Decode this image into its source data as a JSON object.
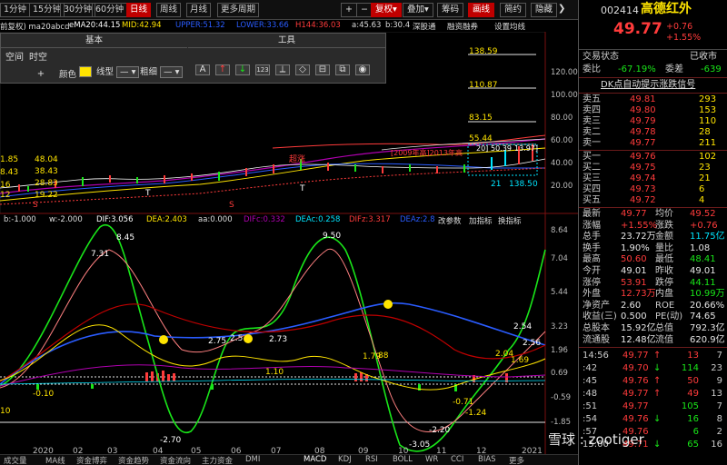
{
  "toolbar": {
    "tabs": [
      "1分钟",
      "15分钟",
      "30分钟",
      "60分钟",
      "日线",
      "周线",
      "月线",
      "更多周期"
    ],
    "active_tab": "日线",
    "buttons": [
      "+",
      "−",
      "复权",
      "叠加",
      "筹码",
      "画线",
      "简约",
      "隐藏"
    ],
    "fuquan_arrow": "▾",
    "dieja_arrow": "▾"
  },
  "ma_strip": {
    "left": "前复权)  ma20abcd",
    "ema20": "eMA20:44.15",
    "mid": "MID:42.94",
    "upr": "UPPER:51.32",
    "lwr": "LOWER:33.66",
    "h1": "H144:36.03",
    "a": "a:45.63",
    "b": "b:30.4",
    "deep": "深股通",
    "margin": "融资融券",
    "setting": "设置均线"
  },
  "drawbar": {
    "hdr_basic": "基本",
    "hdr_tools": "工具",
    "row1": [
      "空间",
      "时空"
    ],
    "plus": "+",
    "color_label": "颜色",
    "linetype_label": "线型",
    "thickness_label": "粗细",
    "tools": [
      "A",
      "↑",
      "↓",
      "123",
      "⟂",
      "◇",
      "⊟",
      "⧉",
      "◉"
    ]
  },
  "main_chart": {
    "right_axis": [
      "120.00",
      "100.00",
      "80.00",
      "60.00",
      "40.00",
      "20.00"
    ],
    "hlines": [
      "138.59",
      "110.87",
      "83.15",
      "55.44"
    ],
    "left_values": [
      "1.85",
      "8.43",
      "16",
      "5.44",
      "18",
      "12",
      "48.04",
      "38.43",
      "28.83",
      "19.22"
    ],
    "annot": [
      "超涨",
      "[2009年高]2013年高",
      "20]",
      "50.39",
      "13.97]",
      "21",
      "138.5",
      "0",
      "S",
      "S",
      "T",
      "T"
    ]
  },
  "ind2": {
    "b": "b:-1.000",
    "w": "w:-2.000",
    "dif": "DIF:3.056",
    "dea": "DEA:2.403",
    "aa": "aa:0.000",
    "difc": "DIFc:0.332",
    "deac": "DEAc:0.258",
    "difz": "DIFz:3.317",
    "deaz": "DEAz:2.8",
    "change": "改参数",
    "add": "加指标",
    "swap": "换指标"
  },
  "sub_chart": {
    "right_axis": [
      "8.64",
      "7.04",
      "5.44",
      "3.23",
      "1.96",
      "0.69",
      "-0.59",
      "-1.85"
    ],
    "labels": [
      "8.45",
      "7.31",
      "2.75",
      "2.5",
      "2.73",
      "1.10",
      "9.50",
      "1.79",
      "88",
      "4.70",
      "2.54",
      "2.56",
      "2.04",
      "1.69",
      "-2.70",
      "-2.20",
      "-0.71",
      "-1.24",
      "-3.05",
      "-0.10",
      "10",
      "-2"
    ],
    "months": [
      "2020",
      "02",
      "03",
      "04",
      "05",
      "06",
      "07",
      "08",
      "09",
      "10",
      "11",
      "12",
      "2021"
    ]
  },
  "bottom_tabs": [
    "成交量",
    "MA线",
    "资金博弈",
    "资金趋势",
    "资金流向",
    "主力资金",
    "DMI",
    "MACD",
    "KDJ",
    "RSI",
    "BOLL",
    "WR",
    "CCI",
    "BIAS",
    "更多"
  ],
  "panel": {
    "code": "002414",
    "name": "高德红外",
    "price": "49.77",
    "change": "+0.76",
    "pct": "+1.55%",
    "state_label": "交易状态",
    "state_value": "已收市",
    "ratio_label": "委比",
    "ratio_value": "-67.19%",
    "diff_label": "委差",
    "diff_value": "-639",
    "signal": "DK点自动提示涨跌信号",
    "asks": [
      {
        "label": "卖五",
        "price": "49.81",
        "vol": "293"
      },
      {
        "label": "卖四",
        "price": "49.80",
        "vol": "153"
      },
      {
        "label": "卖三",
        "price": "49.79",
        "vol": "110"
      },
      {
        "label": "卖二",
        "price": "49.78",
        "vol": "28"
      },
      {
        "label": "卖一",
        "price": "49.77",
        "vol": "211"
      }
    ],
    "bids": [
      {
        "label": "买一",
        "price": "49.76",
        "vol": "102"
      },
      {
        "label": "买二",
        "price": "49.75",
        "vol": "23"
      },
      {
        "label": "买三",
        "price": "49.74",
        "vol": "21"
      },
      {
        "label": "买四",
        "price": "49.73",
        "vol": "6"
      },
      {
        "label": "买五",
        "price": "49.72",
        "vol": "4"
      }
    ],
    "stats": [
      {
        "l1": "最新",
        "v1": "49.77",
        "c1": "red",
        "l2": "均价",
        "v2": "49.52",
        "c2": "red"
      },
      {
        "l1": "涨幅",
        "v1": "+1.55%",
        "c1": "red",
        "l2": "涨跌",
        "v2": "+0.76",
        "c2": "red"
      },
      {
        "l1": "总手",
        "v1": "23.72万",
        "c1": "white",
        "l2": "金额",
        "v2": "11.75亿",
        "c2": "cyan"
      },
      {
        "l1": "换手",
        "v1": "1.90%",
        "c1": "white",
        "l2": "量比",
        "v2": "1.08",
        "c2": "white"
      },
      {
        "l1": "最高",
        "v1": "50.60",
        "c1": "red",
        "l2": "最低",
        "v2": "48.41",
        "c2": "green"
      },
      {
        "l1": "今开",
        "v1": "49.01",
        "c1": "white",
        "l2": "昨收",
        "v2": "49.01",
        "c2": "white"
      },
      {
        "l1": "涨停",
        "v1": "53.91",
        "c1": "red",
        "l2": "跌停",
        "v2": "44.11",
        "c2": "green"
      },
      {
        "l1": "外盘",
        "v1": "12.73万",
        "c1": "red",
        "l2": "内盘",
        "v2": "10.99万",
        "c2": "green"
      },
      {
        "l1": "净资产",
        "v1": "2.60",
        "c1": "white",
        "l2": "ROE",
        "v2": "20.66%",
        "c2": "white"
      },
      {
        "l1": "收益(三)",
        "v1": "0.500",
        "c1": "white",
        "l2": "PE(动)",
        "v2": "74.65",
        "c2": "white"
      },
      {
        "l1": "总股本",
        "v1": "15.92亿",
        "c1": "white",
        "l2": "总值",
        "v2": "792.3亿",
        "c2": "white"
      },
      {
        "l1": "流通股",
        "v1": "12.48亿",
        "c1": "white",
        "l2": "流值",
        "v2": "620.9亿",
        "c2": "white"
      }
    ],
    "ticks": [
      {
        "time": "14:56",
        "price": "49.77",
        "arrow": "↑",
        "vol": "13",
        "n": "7",
        "pc": "red",
        "vc": "red"
      },
      {
        "time": ":42",
        "price": "49.70",
        "arrow": "↓",
        "vol": "114",
        "n": "23",
        "pc": "red",
        "vc": "green"
      },
      {
        "time": ":45",
        "price": "49.76",
        "arrow": "↑",
        "vol": "50",
        "n": "9",
        "pc": "red",
        "vc": "red"
      },
      {
        "time": ":48",
        "price": "49.77",
        "arrow": "↑",
        "vol": "49",
        "n": "13",
        "pc": "red",
        "vc": "red"
      },
      {
        "time": ":51",
        "price": "49.77",
        "arrow": "",
        "vol": "105",
        "n": "7",
        "pc": "red",
        "vc": "green"
      },
      {
        "time": ":54",
        "price": "49.76",
        "arrow": "↓",
        "vol": "16",
        "n": "8",
        "pc": "red",
        "vc": "green"
      },
      {
        "time": ":57",
        "price": "49.76",
        "arrow": "",
        "vol": "6",
        "n": "2",
        "pc": "red",
        "vc": "green"
      },
      {
        "time": "15:00",
        "price": "49.71",
        "arrow": "↓",
        "vol": "65",
        "n": "16",
        "pc": "red",
        "vc": "green"
      }
    ],
    "watermark": "雪球 : zootiger"
  }
}
